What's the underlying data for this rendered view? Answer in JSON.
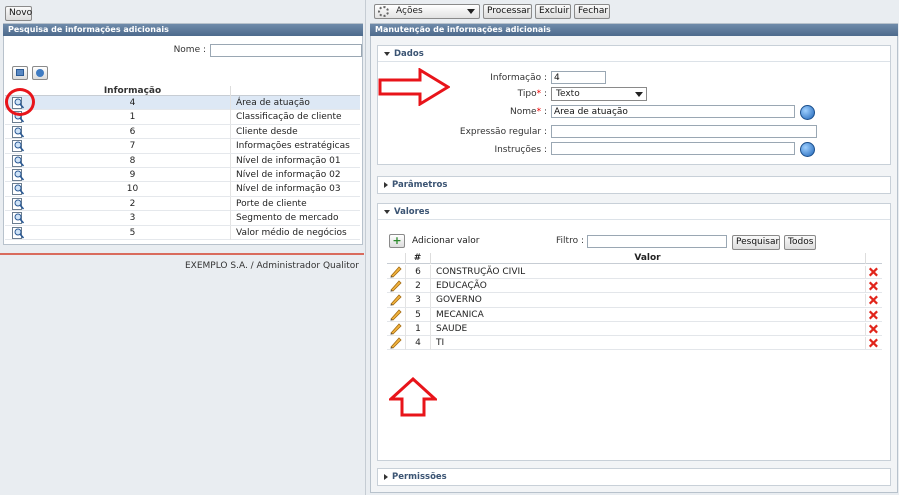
{
  "left": {
    "novo_label": "Novo",
    "panel_title": "Pesquisa de informações adicionais",
    "nome_label": "Nome :",
    "nome_value": "",
    "col_informacao": "Informação",
    "rows": [
      {
        "num": "4",
        "text": "Área de atuação"
      },
      {
        "num": "1",
        "text": "Classificação de cliente"
      },
      {
        "num": "6",
        "text": "Cliente desde"
      },
      {
        "num": "7",
        "text": "Informações estratégicas"
      },
      {
        "num": "8",
        "text": "Nível de informação 01"
      },
      {
        "num": "9",
        "text": "Nível de informação 02"
      },
      {
        "num": "10",
        "text": "Nível de informação 03"
      },
      {
        "num": "2",
        "text": "Porte de cliente"
      },
      {
        "num": "3",
        "text": "Segmento de mercado"
      },
      {
        "num": "5",
        "text": "Valor médio de negócios"
      }
    ],
    "footer": "EXEMPLO S.A. / Administrador Qualitor"
  },
  "toolbar": {
    "acoes_label": "Ações",
    "processar_label": "Processar",
    "excluir_label": "Excluir",
    "fechar_label": "Fechar"
  },
  "right": {
    "panel_title": "Manutenção de informações adicionais",
    "dados": {
      "title": "Dados",
      "informacao_label": "Informação :",
      "informacao_value": "4",
      "tipo_label": "Tipo",
      "tipo_value": "Texto",
      "nome_label": "Nome",
      "nome_value": "Área de atuação",
      "expressao_label": "Expressão regular :",
      "expressao_value": "",
      "instrucoes_label": "Instruções :",
      "instrucoes_value": ""
    },
    "parametros_title": "Parâmetros",
    "valores": {
      "title": "Valores",
      "add_label": "Adicionar valor",
      "filtro_label": "Filtro :",
      "filtro_value": "",
      "pesquisar_label": "Pesquisar",
      "todos_label": "Todos",
      "col_num": "#",
      "col_valor": "Valor",
      "rows": [
        {
          "num": "6",
          "valor": "CONSTRUÇÃO CIVIL"
        },
        {
          "num": "2",
          "valor": "EDUCAÇÃO"
        },
        {
          "num": "3",
          "valor": "GOVERNO"
        },
        {
          "num": "5",
          "valor": "MECANICA"
        },
        {
          "num": "1",
          "valor": "SAUDE"
        },
        {
          "num": "4",
          "valor": "TI"
        }
      ]
    },
    "permissoes_title": "Permissões"
  },
  "colors": {
    "header_blue": "#4d6a8c",
    "highlight_row": "#dde8f5",
    "annotation_red": "#e8141a"
  },
  "icons": [
    "magnifier-icon",
    "pencil-icon",
    "delete-x-icon",
    "globe-help-icon",
    "add-plus-icon",
    "gear-icon",
    "dropdown-arrow-icon",
    "collapse-arrow-icon"
  ]
}
